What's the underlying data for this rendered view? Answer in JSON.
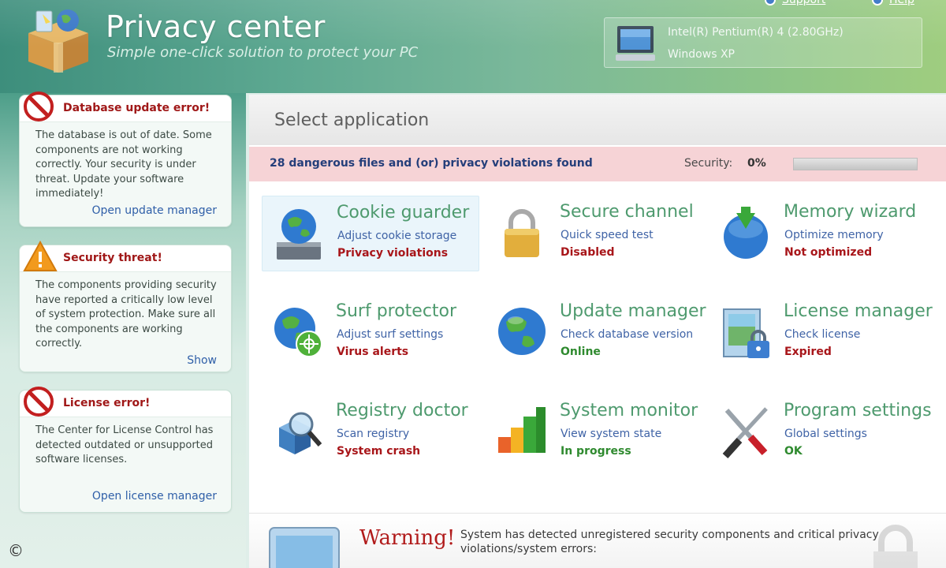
{
  "header": {
    "title": "Privacy center",
    "subtitle": "Simple one-click solution to protect your PC",
    "support_link": "Support",
    "help_link": "Help",
    "system": {
      "cpu": "Intel(R) Pentium(R) 4 (2.80GHz)",
      "os": "Windows XP"
    }
  },
  "sidebar": {
    "alerts": [
      {
        "title": "Database update error!",
        "icon": "error-icon",
        "body": "The database is out of date. Some components are not working correctly. Your security is under threat. Update your software immediately!",
        "link": "Open update manager"
      },
      {
        "title": "Security threat!",
        "icon": "warning-icon",
        "body": "The components providing security have reported a critically low level of system protection. Make sure all the components are working correctly.",
        "link": "Show"
      },
      {
        "title": "License error!",
        "icon": "error-icon",
        "body": "The Center for License Control has detected outdated or unsupported software licenses.",
        "link": "Open license manager"
      }
    ]
  },
  "main": {
    "title": "Select application",
    "threat_message": "28 dangerous files and (or) privacy violations found",
    "security_label": "Security:",
    "security_value": "0%",
    "security_fraction": 0,
    "apps": [
      {
        "name": "Cookie guarder",
        "desc": "Adjust cookie storage",
        "status": "Privacy violations",
        "state": "bad",
        "icon": "cookie-globe-icon"
      },
      {
        "name": "Secure channel",
        "desc": "Quick speed test",
        "status": "Disabled",
        "state": "bad",
        "icon": "padlock-icon"
      },
      {
        "name": "Memory wizard",
        "desc": "Optimize memory",
        "status": "Not optimized",
        "state": "bad",
        "icon": "memory-sphere-icon"
      },
      {
        "name": "Surf protector",
        "desc": "Adjust surf settings",
        "status": "Virus alerts",
        "state": "bad",
        "icon": "surf-globe-icon"
      },
      {
        "name": "Update manager",
        "desc": "Check database version",
        "status": "Online",
        "state": "good",
        "icon": "globe-icon"
      },
      {
        "name": "License manager",
        "desc": "Check license",
        "status": "Expired",
        "state": "bad",
        "icon": "license-lock-icon"
      },
      {
        "name": "Registry doctor",
        "desc": "Scan registry",
        "status": "System crash",
        "state": "bad",
        "icon": "registry-cubes-icon"
      },
      {
        "name": "System monitor",
        "desc": "View system state",
        "status": "In progress",
        "state": "good",
        "icon": "bar-chart-icon"
      },
      {
        "name": "Program settings",
        "desc": "Global settings",
        "status": "OK",
        "state": "good",
        "icon": "tools-icon"
      }
    ],
    "warning": {
      "title": "Warning!",
      "text": "System has detected unregistered security components and critical privacy violations/system errors:"
    }
  },
  "footer": {
    "copyright": "©"
  }
}
